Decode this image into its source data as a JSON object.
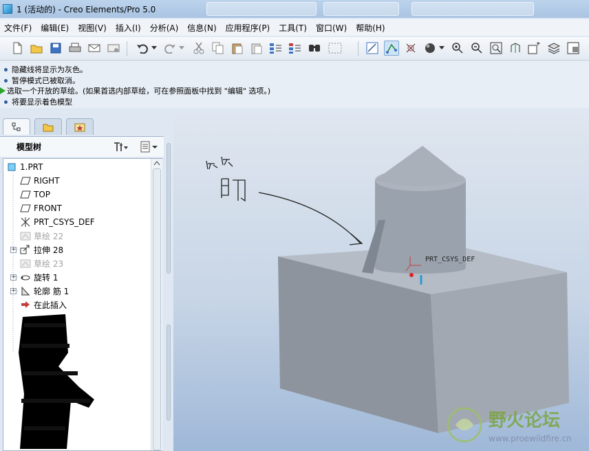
{
  "window": {
    "title": "1 (活动的) - Creo Elements/Pro 5.0"
  },
  "menu": {
    "items": [
      "文件(F)",
      "编辑(E)",
      "视图(V)",
      "插入(I)",
      "分析(A)",
      "信息(N)",
      "应用程序(P)",
      "工具(T)",
      "窗口(W)",
      "帮助(H)"
    ]
  },
  "messages": [
    {
      "type": "info",
      "text": "隐藏线将显示为灰色。"
    },
    {
      "type": "info",
      "text": "暂停模式已被取消。"
    },
    {
      "type": "prompt",
      "text": "选取一个开放的草绘。(如果首选内部草绘，可在参照面板中找到 \"编辑\" 选项。)"
    },
    {
      "type": "info",
      "text": "将要显示着色模型"
    }
  ],
  "model_tree": {
    "header": "模型树",
    "items": [
      {
        "label": "1.PRT",
        "icon": "part-icon",
        "dim": false,
        "expander": false
      },
      {
        "label": "RIGHT",
        "icon": "datum-plane-icon",
        "dim": false,
        "expander": false
      },
      {
        "label": "TOP",
        "icon": "datum-plane-icon",
        "dim": false,
        "expander": false
      },
      {
        "label": "FRONT",
        "icon": "datum-plane-icon",
        "dim": false,
        "expander": false
      },
      {
        "label": "PRT_CSYS_DEF",
        "icon": "csys-icon",
        "dim": false,
        "expander": false
      },
      {
        "label": "草绘 22",
        "icon": "sketch-icon",
        "dim": true,
        "expander": false
      },
      {
        "label": "拉伸 28",
        "icon": "extrude-icon",
        "dim": false,
        "expander": true
      },
      {
        "label": "草绘 23",
        "icon": "sketch-icon",
        "dim": true,
        "expander": false
      },
      {
        "label": "旋转 1",
        "icon": "revolve-icon",
        "dim": false,
        "expander": true
      },
      {
        "label": "轮廓 筋 1",
        "icon": "rib-icon",
        "dim": false,
        "expander": true
      },
      {
        "label": "在此插入",
        "icon": "insert-here-icon",
        "dim": false,
        "expander": false
      }
    ]
  },
  "viewport": {
    "csys_label": "PRT_CSYS_DEF",
    "annotation_text": "筋",
    "watermark_title": "野火论坛",
    "watermark_url": "www.proewildfire.cn"
  },
  "colors": {
    "watermark": "#7aa23a",
    "watermark_url": "#7a86a0"
  }
}
